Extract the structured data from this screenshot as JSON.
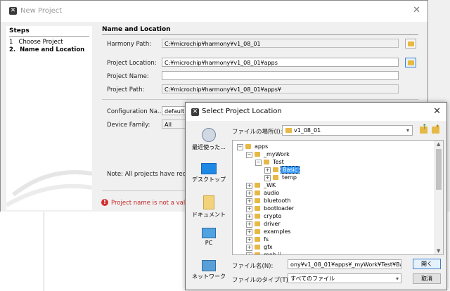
{
  "new_project": {
    "title": "New Project",
    "steps_title": "Steps",
    "steps": [
      {
        "num": "1",
        "label": "Choose Project"
      },
      {
        "num": "2.",
        "label": "Name and Location"
      }
    ],
    "section_title": "Name and Location",
    "harmony_path_label": "Harmony Path:",
    "harmony_path_value": "C:¥microchip¥harmony¥v1_08_01",
    "project_location_label": "Project Location:",
    "project_location_value": "C:¥microchip¥harmony¥v1_08_01¥apps",
    "project_name_label": "Project Name:",
    "project_name_value": "",
    "project_path_label": "Project Path:",
    "project_path_value": "C:¥microchip¥harmony¥v1_08_01¥apps¥",
    "config_name_label": "Configuration Na...",
    "config_name_value": "default",
    "device_family_label": "Device Family:",
    "device_family_value": "All",
    "note_text": "Note:  All projects have reco",
    "error_text": "Project name is not a valid"
  },
  "dialog": {
    "title": "Select Project Location",
    "look_in_label": "ファイルの場所(I):",
    "look_in_value": "v1_08_01",
    "places": [
      {
        "label": "最近使った..."
      },
      {
        "label": "デスクトップ"
      },
      {
        "label": "ドキュメント"
      },
      {
        "label": "PC"
      },
      {
        "label": "ネットワーク"
      }
    ],
    "tree": [
      {
        "label": "apps",
        "toggle": "⊟",
        "indent": 0
      },
      {
        "label": "_myWork",
        "toggle": "⊟",
        "indent": 1
      },
      {
        "label": "Test",
        "toggle": "⊟",
        "indent": 2
      },
      {
        "label": "Basic",
        "toggle": "⊞",
        "indent": 3,
        "selected": true
      },
      {
        "label": "temp",
        "toggle": "⊞",
        "indent": 3
      },
      {
        "label": "_WK",
        "toggle": "⊞",
        "indent": 1
      },
      {
        "label": "audio",
        "toggle": "⊞",
        "indent": 1
      },
      {
        "label": "bluetooth",
        "toggle": "⊞",
        "indent": 1
      },
      {
        "label": "bootloader",
        "toggle": "⊞",
        "indent": 1
      },
      {
        "label": "crypto",
        "toggle": "⊞",
        "indent": 1
      },
      {
        "label": "driver",
        "toggle": "⊞",
        "indent": 1
      },
      {
        "label": "examples",
        "toggle": "⊞",
        "indent": 1
      },
      {
        "label": "fs",
        "toggle": "⊞",
        "indent": 1
      },
      {
        "label": "gfx",
        "toggle": "⊞",
        "indent": 1
      },
      {
        "label": "meb ii",
        "toggle": "⊞",
        "indent": 1
      }
    ],
    "filename_label": "ファイル名(N):",
    "filename_value": "ony¥v1_08_01¥apps¥_myWork¥Test¥Basic",
    "filetype_label": "ファイルのタイプ(T):",
    "filetype_value": "すべてのファイル",
    "open_button": "開く",
    "cancel_button": "取消"
  }
}
